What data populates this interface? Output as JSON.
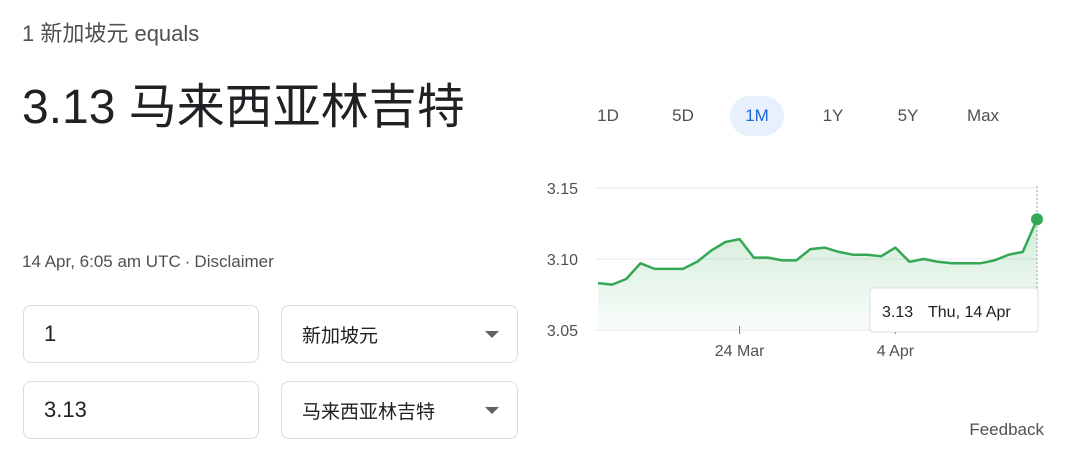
{
  "header": {
    "equals_text": "1 新加坡元 equals"
  },
  "result": {
    "value": "3.13",
    "currency_name": "马来西亚林吉特"
  },
  "meta": {
    "timestamp": "14 Apr, 6:05 am UTC",
    "separator": "·",
    "disclaimer": "Disclaimer"
  },
  "converter": {
    "from": {
      "amount": "1",
      "currency": "新加坡元"
    },
    "to": {
      "amount": "3.13",
      "currency": "马来西亚林吉特"
    }
  },
  "tabs": [
    {
      "label": "1D",
      "active": false
    },
    {
      "label": "5D",
      "active": false
    },
    {
      "label": "1M",
      "active": true
    },
    {
      "label": "1Y",
      "active": false
    },
    {
      "label": "5Y",
      "active": false
    },
    {
      "label": "Max",
      "active": false
    }
  ],
  "tooltip": {
    "value": "3.13",
    "date": "Thu, 14 Apr"
  },
  "feedback_label": "Feedback",
  "colors": {
    "line": "#34a853",
    "active_tab_bg": "#e8f0fe",
    "active_tab_text": "#1967d2"
  },
  "chart_data": {
    "type": "line",
    "y_ticks": [
      "3.15",
      "3.10",
      "3.05"
    ],
    "x_ticks": [
      "24 Mar",
      "4 Apr"
    ],
    "ylim": [
      3.05,
      3.15
    ],
    "grid": true,
    "series": [
      {
        "values": [
          3.083,
          3.082,
          3.086,
          3.097,
          3.093,
          3.093,
          3.093,
          3.098,
          3.106,
          3.112,
          3.114,
          3.101,
          3.101,
          3.099,
          3.099,
          3.107,
          3.108,
          3.105,
          3.103,
          3.103,
          3.102,
          3.108,
          3.098,
          3.1,
          3.098,
          3.097,
          3.097,
          3.097,
          3.099,
          3.103,
          3.105,
          3.128
        ]
      }
    ]
  }
}
